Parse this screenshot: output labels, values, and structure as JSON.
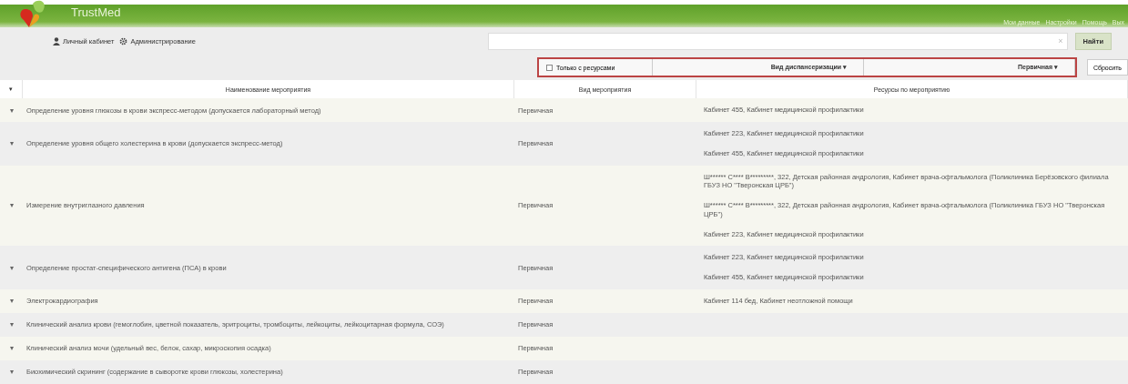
{
  "header": {
    "brand": "TrustMed",
    "nav": [
      "Личный кабинет",
      "Администрирование"
    ],
    "user_links": [
      "Мои данные",
      "Настройки",
      "Помощь",
      "Вых"
    ]
  },
  "search": {
    "button": "Найти",
    "clear": "×"
  },
  "filters": {
    "only_with_resources": {
      "label": "Только с ресурсами",
      "checked": false
    },
    "dropdowns": [
      "Вид диспансеризации",
      "Первичная"
    ],
    "caret": "▾",
    "reset": "Сбросить"
  },
  "table": {
    "columns": [
      "Наименование мероприятия",
      "Вид мероприятия",
      "Ресурсы по мероприятию"
    ],
    "header_marker": "▾",
    "rows": [
      {
        "marker": "▾",
        "name": "Определение уровня глюкозы в крови экспресс-методом (допускается лабораторный метод)",
        "type": "Первичная",
        "resources": [
          "Кабинет 455, Кабинет медицинской профилактики"
        ]
      },
      {
        "marker": "▾",
        "name": "Определение уровня общего холестерина в крови (допускается экспресс-метод)",
        "type": "Первичная",
        "resources": [
          "Кабинет 223, Кабинет медицинской профилактики",
          "Кабинет 455, Кабинет медицинской профилактики"
        ]
      },
      {
        "marker": "▾",
        "name": "Измерение внутриглазного давления",
        "type": "Первичная",
        "resources": [
          "Ш****** С**** В*********, 322, Детская районная андрология, Кабинет врача-офтальмолога (Поликлиника Берёзовского филиала ГБУЗ НО \"Тверонская ЦРБ\")",
          "Ш****** С**** В*********, 322, Детская районная андрология, Кабинет врача-офтальмолога (Поликлиника ГБУЗ НО \"Тверонская ЦРБ\")",
          "Кабинет 223, Кабинет медицинской профилактики"
        ]
      },
      {
        "marker": "▾",
        "name": "Определение простат-специфического антигена (ПСА) в крови",
        "type": "Первичная",
        "resources": [
          "Кабинет 223, Кабинет медицинской профилактики",
          "Кабинет 455, Кабинет медицинской профилактики"
        ]
      },
      {
        "marker": "▾",
        "name": "Электрокардиография",
        "type": "Первичная",
        "resources": [
          "Кабинет 114 бед, Кабинет неотложной помощи"
        ]
      },
      {
        "marker": "▾",
        "name": "Клинический анализ крови (гемоглобин, цветной показатель, эритроциты, тромбоциты, лейкоциты, лейкоцитарная формула, СОЭ)",
        "type": "Первичная",
        "resources": []
      },
      {
        "marker": "▾",
        "name": "Клинический анализ мочи (удельный вес, белок, сахар, микроскопия осадка)",
        "type": "Первичная",
        "resources": []
      },
      {
        "marker": "▾",
        "name": "Биохимический скрининг (содержание в сыворотке крови глюкозы, холестерина)",
        "type": "Первичная",
        "resources": []
      }
    ]
  }
}
